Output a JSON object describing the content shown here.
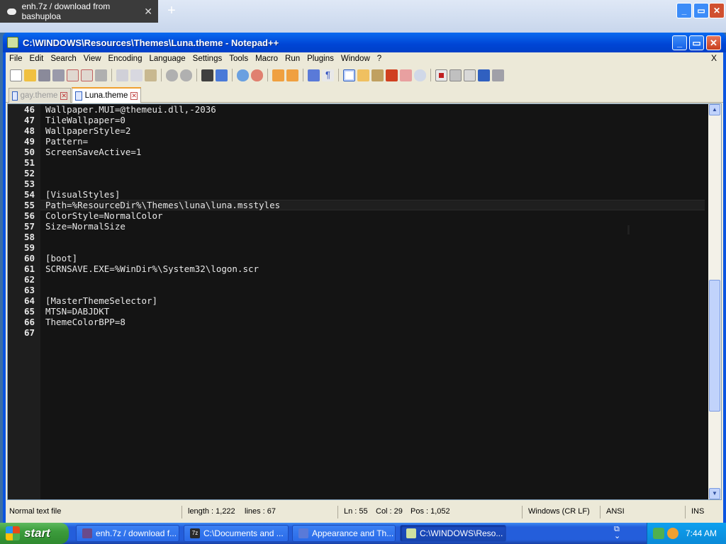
{
  "browser": {
    "tab_title": "enh.7z / download from bashuploa",
    "tab_close": "✕",
    "new_tab": "+",
    "controls": [
      "_",
      "▭",
      "✕"
    ]
  },
  "window": {
    "title": "C:\\WINDOWS\\Resources\\Themes\\Luna.theme - Notepad++",
    "controls": [
      "_",
      "▭",
      "✕"
    ]
  },
  "menu": {
    "items": [
      "File",
      "Edit",
      "Search",
      "View",
      "Encoding",
      "Language",
      "Settings",
      "Tools",
      "Macro",
      "Run",
      "Plugins",
      "Window",
      "?"
    ],
    "close": "X"
  },
  "toolbar": {
    "icons": [
      "new-icon",
      "open-icon",
      "save-icon",
      "save-all-icon",
      "close-icon",
      "close-all-icon",
      "print-icon",
      "cut-icon",
      "copy-icon",
      "paste-icon",
      "undo-icon",
      "redo-icon",
      "find-icon",
      "replace-icon",
      "zoom-in-icon",
      "zoom-out-icon",
      "sync-v-icon",
      "sync-h-icon",
      "wrap-icon",
      "all-chars-icon",
      "indent-guide-icon",
      "udl-icon",
      "doc-map-icon",
      "function-list-icon",
      "folder-workspace-icon",
      "monitor-icon",
      "record-icon",
      "stop-icon",
      "play-icon",
      "play-multiple-icon",
      "save-macro-icon"
    ]
  },
  "tabs": [
    {
      "label": "gay.theme",
      "active": false
    },
    {
      "label": "Luna.theme",
      "active": true
    }
  ],
  "editor": {
    "lines": [
      {
        "n": "46",
        "text": "Wallpaper.MUI=@themeui.dll,-2036"
      },
      {
        "n": "47",
        "text": "TileWallpaper=0"
      },
      {
        "n": "48",
        "text": "WallpaperStyle=2"
      },
      {
        "n": "49",
        "text": "Pattern="
      },
      {
        "n": "50",
        "text": "ScreenSaveActive=1"
      },
      {
        "n": "51",
        "text": ""
      },
      {
        "n": "52",
        "text": ""
      },
      {
        "n": "53",
        "text": ""
      },
      {
        "n": "54",
        "text": "[VisualStyles]"
      },
      {
        "n": "55",
        "text": "Path=%ResourceDir%\\Themes\\luna\\luna.msstyles"
      },
      {
        "n": "56",
        "text": "ColorStyle=NormalColor"
      },
      {
        "n": "57",
        "text": "Size=NormalSize"
      },
      {
        "n": "58",
        "text": ""
      },
      {
        "n": "59",
        "text": ""
      },
      {
        "n": "60",
        "text": "[boot]"
      },
      {
        "n": "61",
        "text": "SCRNSAVE.EXE=%WinDir%\\System32\\logon.scr"
      },
      {
        "n": "62",
        "text": ""
      },
      {
        "n": "63",
        "text": ""
      },
      {
        "n": "64",
        "text": "[MasterThemeSelector]"
      },
      {
        "n": "65",
        "text": "MTSN=DABJDKT"
      },
      {
        "n": "66",
        "text": "ThemeColorBPP=8"
      },
      {
        "n": "67",
        "text": ""
      }
    ],
    "current_line": "55"
  },
  "status": {
    "type": "Normal text file",
    "length": "length : 1,222",
    "lines": "lines : 67",
    "ln": "Ln : 55",
    "col": "Col : 29",
    "pos": "Pos : 1,052",
    "eol": "Windows (CR LF)",
    "encoding": "ANSI",
    "mode": "INS"
  },
  "taskbar": {
    "start": "start",
    "tasks": [
      {
        "label": "enh.7z / download f...",
        "icon_color": "#6a4a8a",
        "active": false
      },
      {
        "label": "C:\\Documents and ...",
        "icon_color": "#2a2a2a",
        "active": false
      },
      {
        "label": "Appearance and Th...",
        "icon_color": "#5a7ad8",
        "active": false
      },
      {
        "label": "C:\\WINDOWS\\Reso...",
        "icon_color": "#cfe0a0",
        "active": true
      }
    ],
    "clock": "7:44 AM"
  },
  "colors": {
    "editor_bg": "#141414",
    "editor_fg": "#e8e8e8",
    "titlebar": "#0045d5"
  }
}
